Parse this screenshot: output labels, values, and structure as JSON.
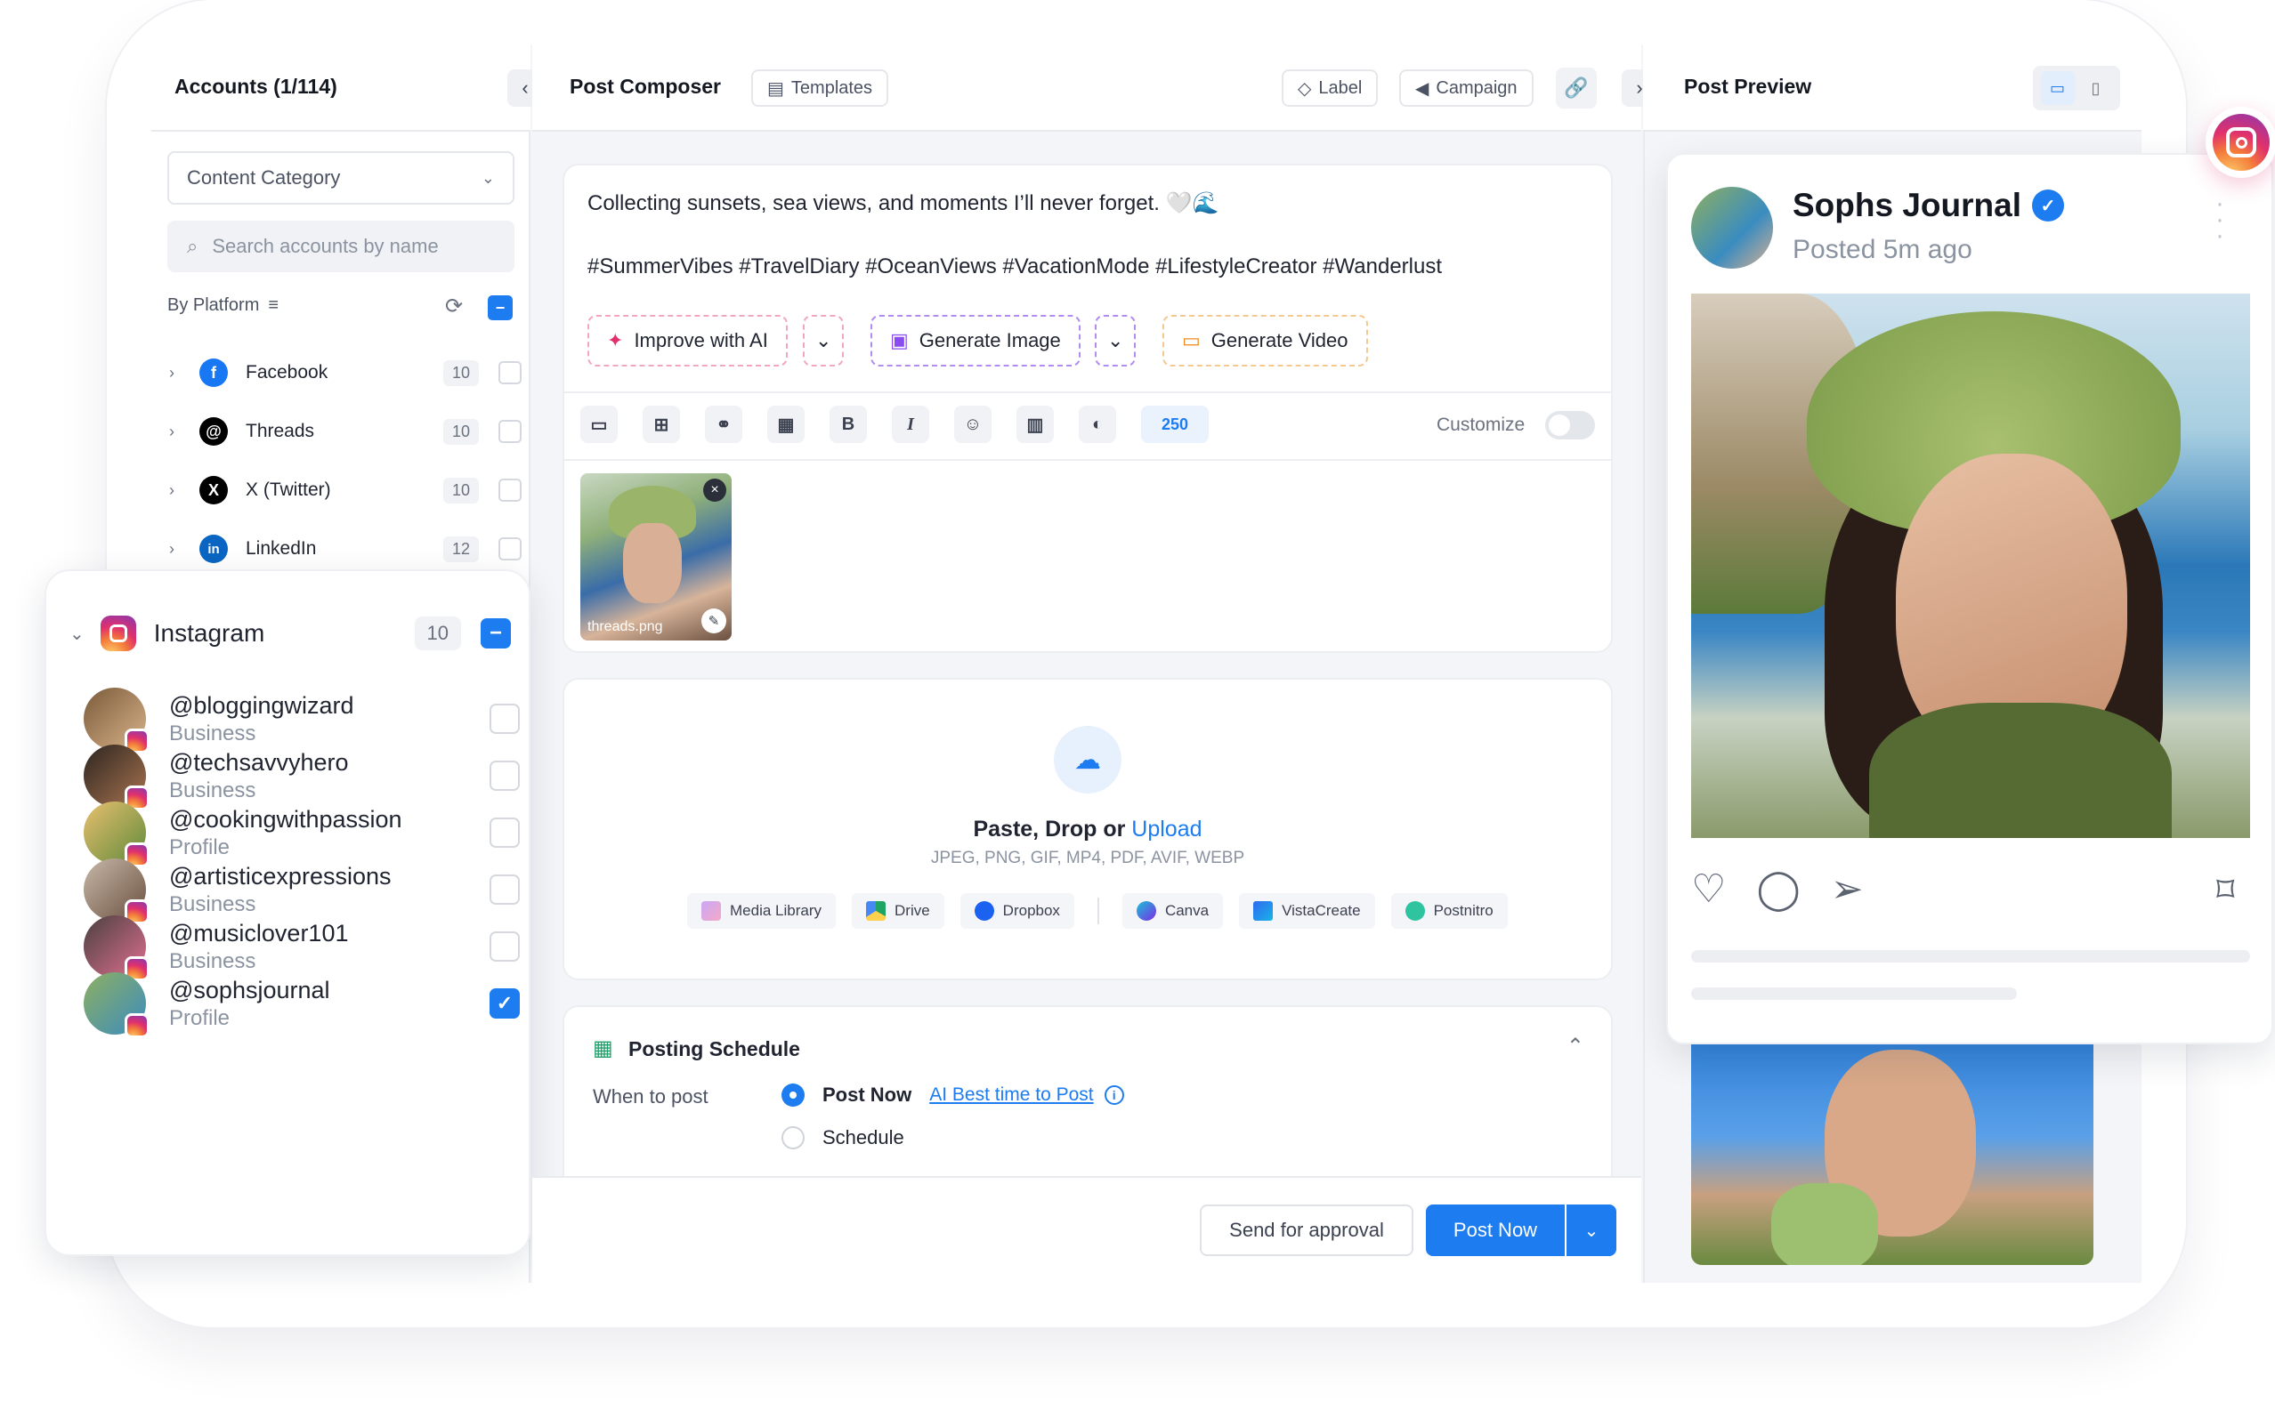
{
  "accounts_header": "Accounts (1/114)",
  "content_category": "Content Category",
  "search_placeholder": "Search accounts by name",
  "by_platform": "By Platform",
  "platforms": [
    {
      "label": "Facebook",
      "count": "10"
    },
    {
      "label": "Threads",
      "count": "10"
    },
    {
      "label": "X (Twitter)",
      "count": "10"
    },
    {
      "label": "LinkedIn",
      "count": "12"
    }
  ],
  "instagram": {
    "label": "Instagram",
    "count": "10",
    "accounts": [
      {
        "handle": "@bloggingwizard",
        "type": "Business",
        "checked": false
      },
      {
        "handle": "@techsavvyhero",
        "type": "Business",
        "checked": false
      },
      {
        "handle": "@cookingwithpassion",
        "type": "Profile",
        "checked": false
      },
      {
        "handle": "@artisticexpressions",
        "type": "Business",
        "checked": false
      },
      {
        "handle": "@musiclover101",
        "type": "Business",
        "checked": false
      },
      {
        "handle": "@sophsjournal",
        "type": "Profile",
        "checked": true
      }
    ]
  },
  "composer": {
    "title": "Post Composer",
    "templates": "Templates",
    "label": "Label",
    "campaign": "Campaign",
    "caption_line1": "Collecting sunsets, sea views, and moments I’ll never forget. 🤍🌊",
    "caption_line2": "#SummerVibes #TravelDiary #OceanViews #VacationMode #LifestyleCreator #Wanderlust",
    "improve_ai": "Improve with AI",
    "generate_image": "Generate Image",
    "generate_video": "Generate Video",
    "char_count": "250",
    "customize": "Customize",
    "attachment_name": "threads.png"
  },
  "upload": {
    "paste_drop": "Paste, Drop or ",
    "upload_link": "Upload",
    "formats": "JPEG, PNG, GIF, MP4, PDF, AVIF, WEBP",
    "sources": [
      "Media Library",
      "Drive",
      "Dropbox",
      "Canva",
      "VistaCreate",
      "Postnitro"
    ]
  },
  "schedule": {
    "title": "Posting Schedule",
    "when": "When to post",
    "post_now": "Post Now",
    "ai_best": "AI Best time to Post",
    "schedule": "Schedule"
  },
  "footer": {
    "send_approval": "Send for approval",
    "post_now": "Post Now"
  },
  "preview": {
    "title": "Post Preview",
    "name": "Sophs Journal",
    "posted": "Posted 5m ago"
  },
  "colors": {
    "accent": "#1c7cf0",
    "instagram": "#e1306c",
    "verified": "#1c7cf0"
  }
}
